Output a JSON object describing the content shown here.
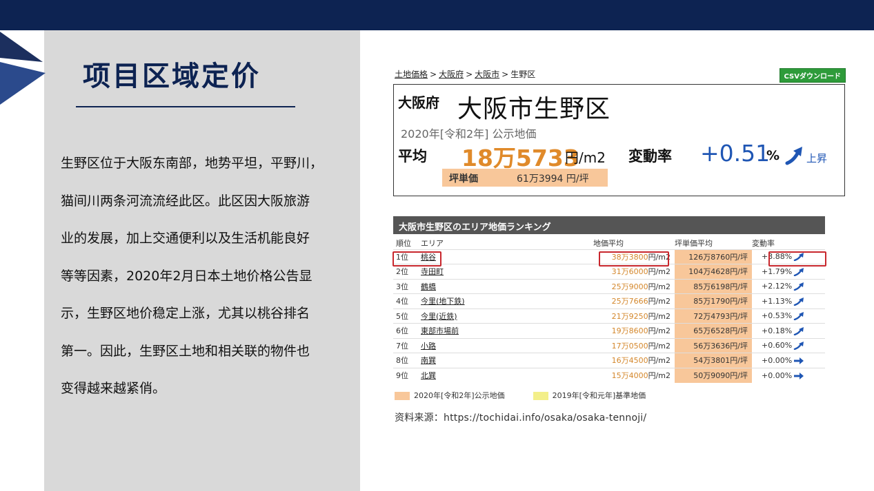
{
  "slide": {
    "title": "项目区域定价",
    "body_lines": [
      "生野区位于大阪东南部，地势平坦，平野川，",
      "猫间川两条河流流经此区。此区因大阪旅游",
      "业的发展，加上交通便利以及生活机能良好",
      "等等因素，2020年2月日本土地价格公告显",
      "示，生野区地价稳定上涨，尤其以桃谷排名",
      "第一。因此，生野区土地和相关联的物件也",
      "变得越来越紧俏。"
    ],
    "source": "资料来源：https://tochidai.info/osaka/osaka-tennoji/",
    "colors": {
      "navy": "#0d2352",
      "panel": "#d9d9d9",
      "accent_orange": "#e08a2a",
      "accent_blue": "#1f56b4"
    }
  },
  "screenshot": {
    "breadcrumb": [
      "土地価格",
      "大阪府",
      "大阪市",
      "生野区"
    ],
    "csv_button": "CSVダウンロード",
    "prefecture": "大阪府",
    "ward": "大阪市生野区",
    "year_line": "2020年[令和2年] 公示地価",
    "avg_label": "平均",
    "avg_value": "18万5733",
    "avg_unit": "円/m2",
    "rate_label": "変動率",
    "rate_value": "+0.51",
    "rate_pct": "%",
    "rate_trend": "上昇",
    "tsubo_label": "坪単価",
    "tsubo_value": "61万3994 円/坪",
    "ranking_title": "大阪市生野区のエリア地価ランキング",
    "columns": [
      "順位",
      "エリア",
      "地価平均",
      "坪単価平均",
      "変動率"
    ],
    "rows": [
      {
        "rank": "1位",
        "area": "桃谷",
        "price": "38万3800",
        "price_unit": "円/m2",
        "tsubo": "126万8760円/坪",
        "rate": "+3.88%",
        "trend": "up-arrow-icon"
      },
      {
        "rank": "2位",
        "area": "寺田町",
        "price": "31万6000",
        "price_unit": "円/m2",
        "tsubo": "104万4628円/坪",
        "rate": "+1.79%",
        "trend": "up-arrow-icon"
      },
      {
        "rank": "3位",
        "area": "鶴橋",
        "price": "25万9000",
        "price_unit": "円/m2",
        "tsubo": "85万6198円/坪",
        "rate": "+2.12%",
        "trend": "up-arrow-icon"
      },
      {
        "rank": "4位",
        "area": "今里(地下鉄)",
        "price": "25万7666",
        "price_unit": "円/m2",
        "tsubo": "85万1790円/坪",
        "rate": "+1.13%",
        "trend": "up-arrow-icon"
      },
      {
        "rank": "5位",
        "area": "今里(近鉄)",
        "price": "21万9250",
        "price_unit": "円/m2",
        "tsubo": "72万4793円/坪",
        "rate": "+0.53%",
        "trend": "up-arrow-icon"
      },
      {
        "rank": "6位",
        "area": "東部市場前",
        "price": "19万8600",
        "price_unit": "円/m2",
        "tsubo": "65万6528円/坪",
        "rate": "+0.18%",
        "trend": "up-arrow-icon"
      },
      {
        "rank": "7位",
        "area": "小路",
        "price": "17万0500",
        "price_unit": "円/m2",
        "tsubo": "56万3636円/坪",
        "rate": "+0.60%",
        "trend": "up-arrow-icon"
      },
      {
        "rank": "8位",
        "area": "南巽",
        "price": "16万4500",
        "price_unit": "円/m2",
        "tsubo": "54万3801円/坪",
        "rate": "+0.00%",
        "trend": "right-arrow-icon"
      },
      {
        "rank": "9位",
        "area": "北巽",
        "price": "15万4000",
        "price_unit": "円/m2",
        "tsubo": "50万9090円/坪",
        "rate": "+0.00%",
        "trend": "right-arrow-icon"
      }
    ],
    "legend": [
      {
        "label": "2020年[令和2年]公示地価",
        "color": "#f8c79a"
      },
      {
        "label": "2019年[令和元年]基準地価",
        "color": "#f3ef8a"
      }
    ]
  }
}
